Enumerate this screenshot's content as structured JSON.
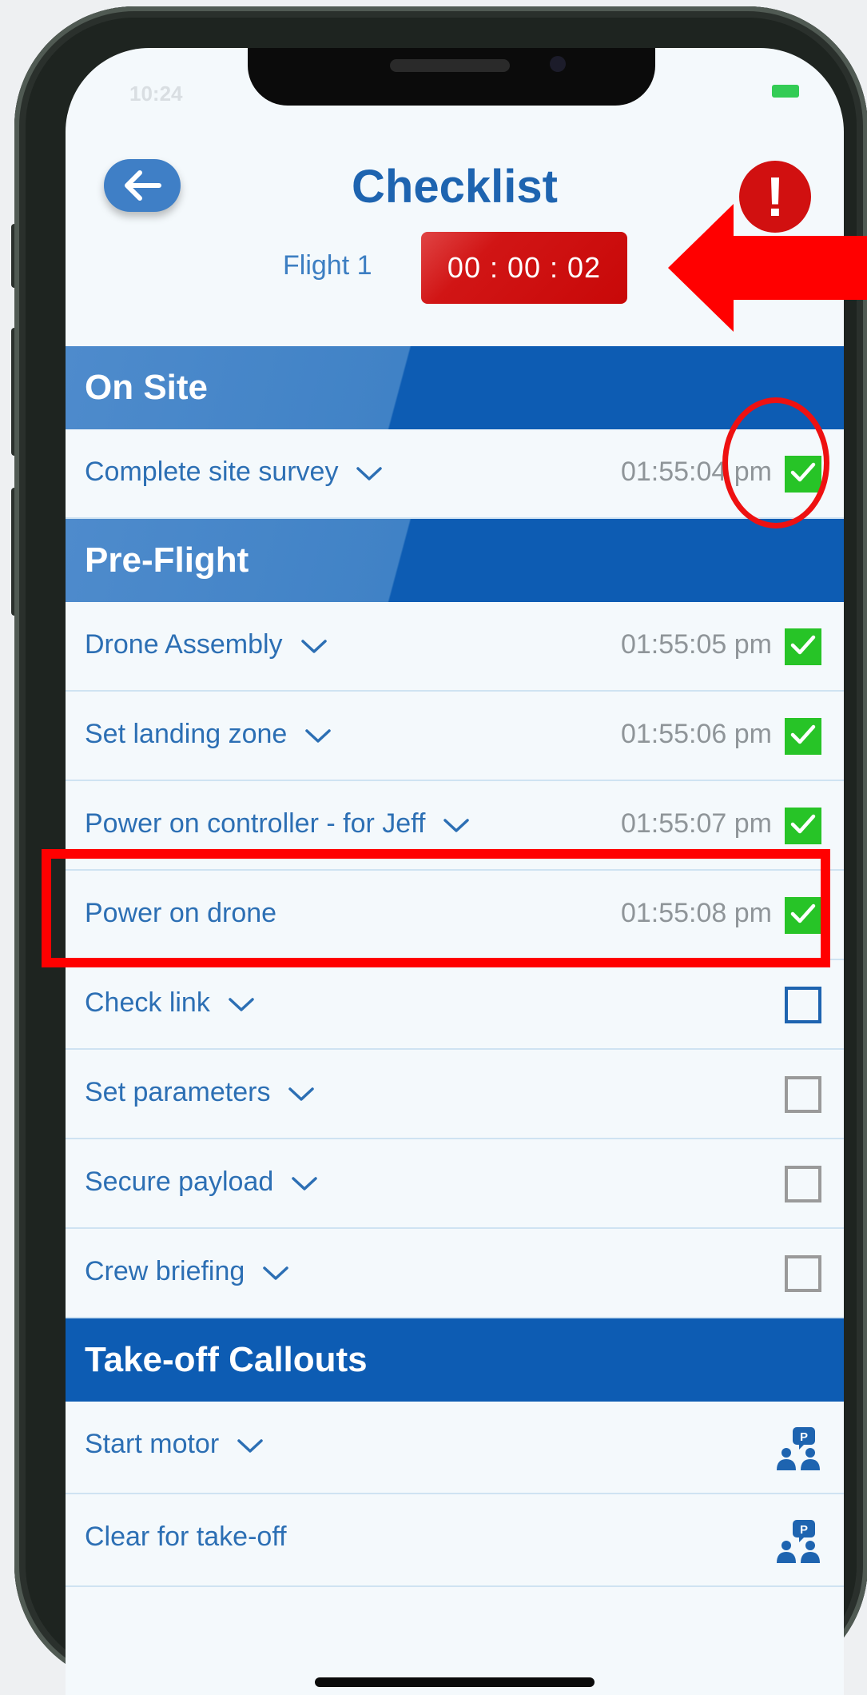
{
  "status_bar": {
    "time": "10:24"
  },
  "header": {
    "title": "Checklist",
    "flight_label": "Flight 1",
    "timer": "00 : 00 : 02"
  },
  "sections": [
    {
      "title": "On Site",
      "items": [
        {
          "label": "Complete site survey",
          "time": "01:55:04 pm",
          "state": "checked",
          "expandable": true
        }
      ]
    },
    {
      "title": "Pre-Flight",
      "items": [
        {
          "label": "Drone Assembly",
          "time": "01:55:05 pm",
          "state": "checked",
          "expandable": true
        },
        {
          "label": "Set landing zone",
          "time": "01:55:06 pm",
          "state": "checked",
          "expandable": true
        },
        {
          "label": "Power on controller - for Jeff",
          "time": "01:55:07 pm",
          "state": "checked",
          "expandable": true
        },
        {
          "label": "Power on drone",
          "time": "01:55:08 pm",
          "state": "checked",
          "expandable": false
        },
        {
          "label": "Check link",
          "time": "",
          "state": "active",
          "expandable": true
        },
        {
          "label": "Set parameters",
          "time": "",
          "state": "unchecked",
          "expandable": true
        },
        {
          "label": "Secure payload",
          "time": "",
          "state": "unchecked",
          "expandable": true
        },
        {
          "label": "Crew briefing",
          "time": "",
          "state": "unchecked",
          "expandable": true
        }
      ]
    },
    {
      "title": "Take-off Callouts",
      "items": [
        {
          "label": "Start motor",
          "icon": "crew-callout-icon",
          "expandable": true
        },
        {
          "label": "Clear for take-off",
          "icon": "crew-callout-icon",
          "expandable": false
        }
      ]
    }
  ],
  "colors": {
    "primary": "#1e64b0",
    "section_bg": "#0d5cb3",
    "timer_bg": "#d11515",
    "check_green": "#27c427",
    "annotation_red": "#ff0000"
  }
}
